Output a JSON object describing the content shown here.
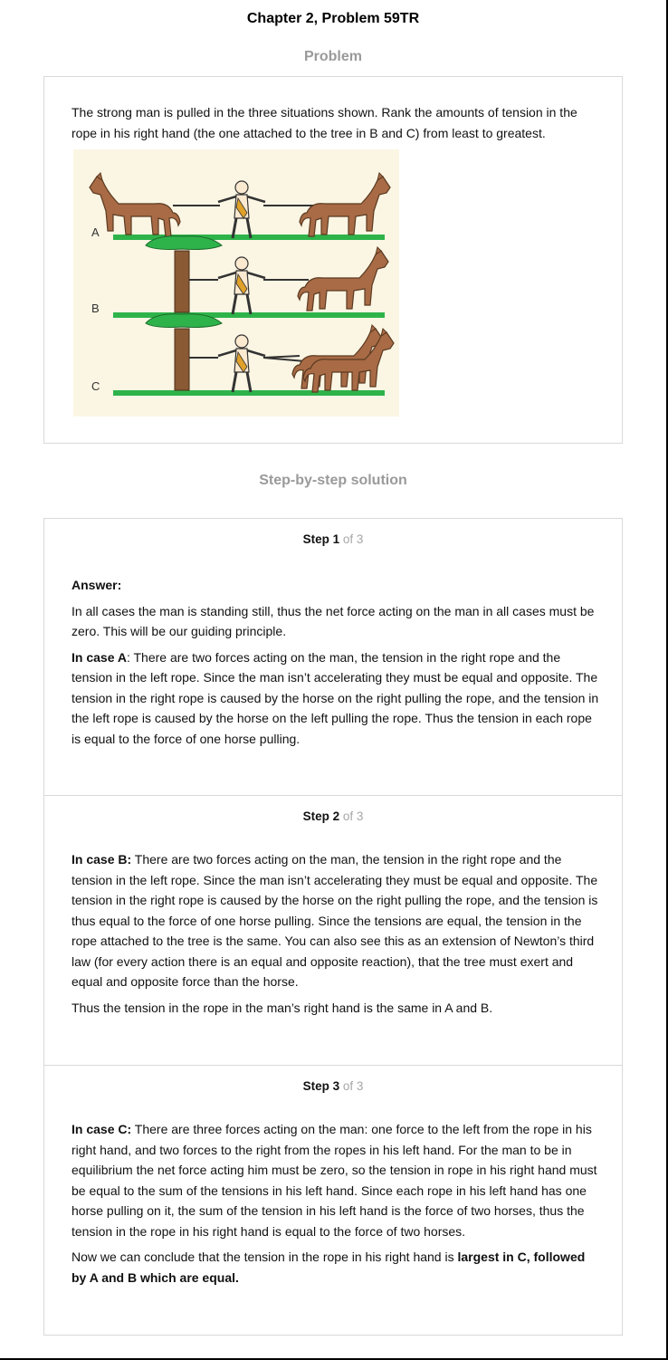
{
  "title": "Chapter 2, Problem 59TR",
  "problem": {
    "heading": "Problem",
    "text": "The strong man is pulled in the three situations shown. Rank the amounts of tension in the rope in his right hand (the one attached to the tree in B and C) from least to greatest.",
    "figure_labels": [
      "A",
      "B",
      "C"
    ]
  },
  "solution": {
    "heading": "Step-by-step solution",
    "steps": [
      {
        "label": "Step",
        "number": "1",
        "of": "of 3",
        "answer_label": "Answer:",
        "p1": "In all cases the man is standing still, thus the net force acting on the man in all cases must be zero. This will be our guiding principle.",
        "p2_bold": "In case A",
        "p2": ": There are two forces acting on the man, the tension in the right rope and the tension in the left rope. Since the man isn’t accelerating they must be equal and opposite. The tension in the right rope is caused by the horse on the right pulling the rope, and the tension in the left rope is caused by the horse on the left pulling the rope. Thus the tension in each rope is equal to the force of one horse pulling."
      },
      {
        "label": "Step",
        "number": "2",
        "of": "of 3",
        "p1_bold": "In case B:",
        "p1": " There are two forces acting on the man, the tension in the right rope and the tension in the left rope. Since the man isn’t accelerating they must be equal and opposite. The tension in the right rope is caused by the horse on the right pulling the rope, and the tension is thus equal to the force of one horse pulling. Since the tensions are equal, the tension in the rope attached to the tree is the same. You can also see this as an extension of Newton’s third law (for every action there is an equal and opposite reaction), that the tree must exert and equal and opposite force than the horse.",
        "p2": "Thus the tension in the rope in the man’s right hand is the same in A and B."
      },
      {
        "label": "Step",
        "number": "3",
        "of": "of 3",
        "p1_bold": "In case C:",
        "p1": " There are three forces acting on the man: one force to the left from the rope in his right hand, and two forces to the right from the ropes in his left hand. For the man to be in equilibrium the net force acting him must be zero, so the tension in rope in his right hand must be equal to the sum of the tensions in his left hand. Since each rope in his left hand has one horse pulling on it, the sum of the tension in his left hand is the force of two horses, thus the tension in the rope in his right hand is equal to the force of two horses.",
        "p2": "Now we can conclude that the tension in the rope in his right hand is ",
        "p2_bold": "largest in C, followed by A and B which are equal."
      }
    ]
  },
  "colors": {
    "heading_gray": "#9a9a9a",
    "border": "#d9d9d9",
    "figure_bg": "#fbf6e3",
    "grass": "#2eb34a",
    "horse": "#a86b45",
    "tree_trunk": "#8a5a34"
  }
}
